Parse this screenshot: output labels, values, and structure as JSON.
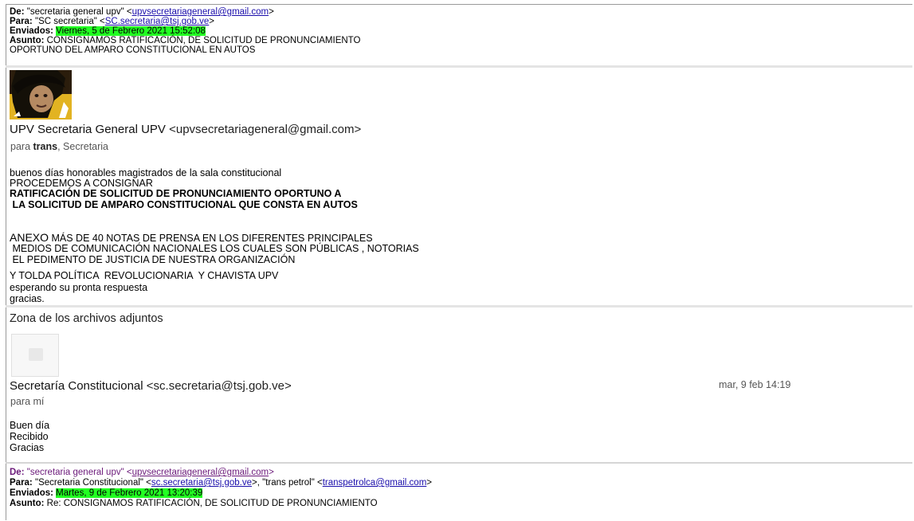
{
  "forwarded1": {
    "from_label": "De:",
    "from_name": "\"secretaria general upv\" <",
    "from_email": "upvsecretariageneral@gmail.com",
    "from_close": ">",
    "to_label": "Para:",
    "to_name": "\"SC secretaria\" <",
    "to_email": "SC.secretaria@tsj.gob.ve",
    "to_close": ">",
    "sent_label": "Enviados:",
    "sent_value": "Viernes, 5 de Febrero 2021 15:52:08",
    "subject_label": "Asunto:",
    "subject_line1": "CONSIGNAMOS RATIFICACIÓN, DE SOLICITUD DE PRONUNCIAMIENTO",
    "subject_line2": "OPORTUNO DEL AMPARO CONSTITUCIONAL EN AUTOS"
  },
  "message1": {
    "sender_name": "UPV Secretaria General UPV",
    "sender_email": "<upvsecretariageneral@gmail.com>",
    "recipients_prefix": "para",
    "recipients_strong": "trans",
    "recipients_rest": ", Secretaria",
    "body_line1": "buenos días honorables magistrados de la sala constitucional",
    "body_line2": "PROCEDEMOS A CONSIGNAR",
    "body_line3": "RATIFICACIÓN DE SOLICITUD DE PRONUNCIAMIENTO OPORTUNO A",
    "body_line4": " LA SOLICITUD DE AMPARO CONSTITUCIONAL QUE CONSTA EN AUTOS",
    "body_line5a": "ANEXO",
    "body_line5b": " MÁS DE 40 NOTAS DE PRENSA EN LOS DIFERENTES PRINCIPALES",
    "body_line6": " MEDIOS DE COMUNICACIÓN NACIONALES LOS CUALES SON PÚBLICAS , NOTORIAS",
    "body_line7": " EL PEDIMENTO DE JUSTICIA DE NUESTRA ORGANIZACIÓN",
    "body_line8": "Y TOLDA POLÍTICA  REVOLUCIONARIA  Y CHAVISTA UPV",
    "body_line9": "esperando su pronta respuesta",
    "body_line10": "gracias."
  },
  "attachments": {
    "title": "Zona de los archivos adjuntos"
  },
  "message2": {
    "sender_name": "Secretaría Constitucional",
    "sender_email": "<sc.secretaria@tsj.gob.ve>",
    "recipients": "para mí",
    "date": "mar, 9 feb 14:19",
    "body_line1": "Buen día",
    "body_line2": "Recibido",
    "body_line3": "Gracias"
  },
  "forwarded2": {
    "from_label": "De:",
    "from_name": "\"secretaria general upv\" <",
    "from_email": "upvsecretariageneral@gmail.com",
    "from_close": ">",
    "to_label": "Para:",
    "to_name": "\"Secretaria Constitucional\" <",
    "to_email": "sc.secretaria@tsj.gob.ve",
    "to_mid": ">, \"trans petrol\" <",
    "to_email2": "transpetrolca@gmail.com",
    "to_close": ">",
    "sent_label": "Enviados:",
    "sent_value": "Martes, 9 de Febrero 2021 13:20:39",
    "subject_label": "Asunto:",
    "subject_line1": "Re: CONSIGNAMOS RATIFICACIÓN, DE SOLICITUD DE PRONUNCIAMIENTO"
  }
}
